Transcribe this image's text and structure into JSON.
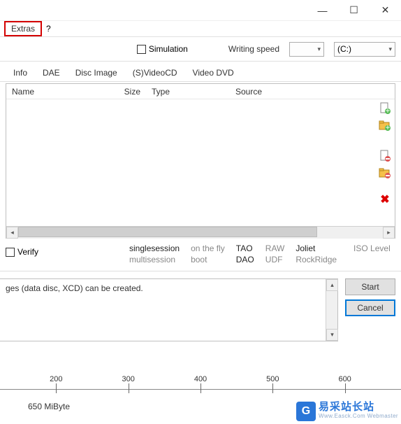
{
  "window": {
    "minimize": "—",
    "maximize": "☐",
    "close": "✕"
  },
  "menu": {
    "extras": "Extras",
    "help": "?"
  },
  "toolbar": {
    "simulation": "Simulation",
    "writing_speed_label": "Writing speed",
    "writing_speed_value": "",
    "drive_value": "(C:)"
  },
  "tabs": {
    "items": [
      "Info",
      "DAE",
      "Disc Image",
      "(S)VideoCD",
      "Video DVD"
    ]
  },
  "columns": {
    "name": "Name",
    "size": "Size",
    "type": "Type",
    "source": "Source"
  },
  "side_icons": {
    "add_file": "add-file-icon",
    "add_folder": "add-folder-icon",
    "remove_file": "remove-file-icon",
    "remove_folder": "remove-folder-icon",
    "delete_all": "delete-all-icon"
  },
  "options": {
    "verify": "Verify",
    "col1": {
      "top": "singlesession",
      "bottom": "multisession"
    },
    "col2": {
      "top": "on the fly",
      "bottom": "boot"
    },
    "col3": {
      "top": "TAO",
      "bottom": "DAO"
    },
    "col4": {
      "top": "RAW",
      "bottom": "UDF"
    },
    "col5": {
      "top": "Joliet",
      "bottom": "RockRidge"
    },
    "iso": "ISO Level"
  },
  "log": {
    "line": "ges (data disc, XCD) can be created."
  },
  "buttons": {
    "start": "Start",
    "cancel": "Cancel"
  },
  "ruler": {
    "ticks": [
      "200",
      "300",
      "400",
      "500",
      "600"
    ]
  },
  "capacity": "650 MiByte",
  "watermark": {
    "cn": "易采站长站",
    "en": "Www.Easck.Com Webmaster"
  }
}
